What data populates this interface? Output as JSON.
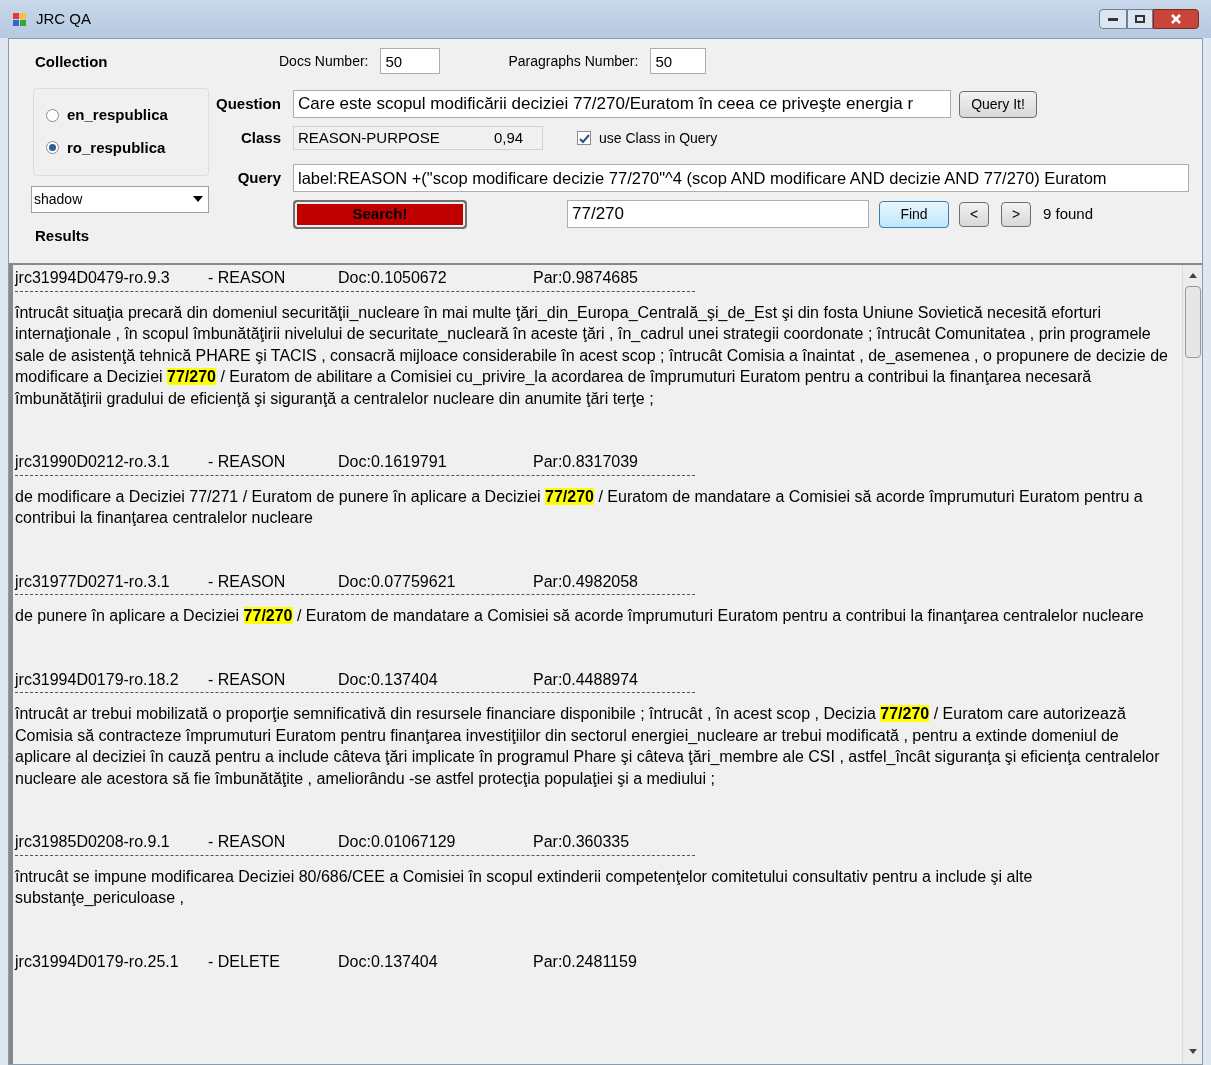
{
  "window": {
    "title": "JRC QA"
  },
  "collection": {
    "label": "Collection",
    "options": [
      {
        "label": "en_respublica",
        "selected": false
      },
      {
        "label": "ro_respublica",
        "selected": true
      }
    ]
  },
  "docs_number": {
    "label": "Docs Number:",
    "value": "50"
  },
  "paragraphs_number": {
    "label": "Paragraphs Number:",
    "value": "50"
  },
  "index_dropdown": {
    "value": "shadow"
  },
  "results_label": "Results",
  "question": {
    "label": "Question",
    "value": "Care este scopul modificării deciziei 77/270/Euratom în ceea ce priveşte energia r"
  },
  "query_button": "Query It!",
  "class": {
    "label": "Class",
    "value": "REASON-PURPOSE",
    "score": "0,94"
  },
  "use_class": {
    "label": "use Class in Query",
    "checked": true
  },
  "query": {
    "label": "Query",
    "value": "label:REASON +(\"scop modificare decizie 77/270\"^4 (scop AND modificare AND decizie AND 77/270) Euratom"
  },
  "search_button": "Search!",
  "find": {
    "value": "77/270",
    "button": "Find",
    "prev": "<",
    "next": ">",
    "count": "9 found"
  },
  "results": [
    {
      "id": "jrc31994D0479-ro.9.3",
      "label": "- REASON",
      "doc": "Doc:0.1050672",
      "par": "Par:0.9874685",
      "text": "întrucât situaţia precară din domeniul securităţii_nucleare în mai multe ţări_din_Europa_Centrală_şi_de_Est şi din fosta Uniune Sovietică necesită eforturi internaţionale , în scopul îmbunătăţirii nivelului de securitate_nucleară în aceste ţări , în_cadrul unei strategii coordonate ; întrucât Comunitatea , prin programele sale de asistenţă tehnică PHARE şi TACIS , consacră mijloace considerabile în acest scop ; întrucât Comisia a înaintat , de_asemenea , o propunere de decizie de modificare a Deciziei **77/270** / Euratom de abilitare a Comisiei cu_privire_la acordarea de împrumuturi Euratom pentru a contribui la finanţarea necesară îmbunătăţirii gradului de eficienţă şi siguranţă a centralelor nucleare din anumite ţări terţe ;"
    },
    {
      "id": "jrc31990D0212-ro.3.1",
      "label": "- REASON",
      "doc": "Doc:0.1619791",
      "par": "Par:0.8317039",
      "text": "de modificare a Deciziei 77/271 / Euratom de punere în aplicare a Deciziei **77/270** / Euratom de mandatare a Comisiei să acorde împrumuturi Euratom pentru a contribui la finanţarea centralelor nucleare"
    },
    {
      "id": "jrc31977D0271-ro.3.1",
      "label": "- REASON",
      "doc": "Doc:0.07759621",
      "par": "Par:0.4982058",
      "text": "de punere în aplicare a Deciziei **77/270** / Euratom de mandatare a Comisiei să acorde împrumuturi Euratom pentru a contribui la finanţarea centralelor nucleare"
    },
    {
      "id": "jrc31994D0179-ro.18.2",
      "label": "- REASON",
      "doc": "Doc:0.137404",
      "par": "Par:0.4488974",
      "text": "întrucât ar trebui mobilizată o proporţie semnificativă din resursele financiare disponibile ; întrucât , în acest scop , Decizia **77/270** / Euratom care autorizează Comisia să contracteze împrumuturi Euratom pentru finanţarea investiţiilor din sectorul energiei_nucleare ar trebui modificată , pentru a extinde domeniul de aplicare al deciziei în cauză pentru a include câteva ţări implicate în programul Phare şi câteva ţări_membre ale CSI , astfel_încât siguranţa şi eficienţa centralelor nucleare ale acestora să fie îmbunătăţite , ameliorându -se astfel protecţia populaţiei şi a mediului ;"
    },
    {
      "id": "jrc31985D0208-ro.9.1",
      "label": "- REASON",
      "doc": "Doc:0.01067129",
      "par": "Par:0.360335",
      "text": "întrucât se impune modificarea Deciziei 80/686/CEE a Comisiei în scopul extinderii competenţelor comitetului consultativ pentru a include şi alte substanţe_periculoase ,"
    },
    {
      "id": "jrc31994D0179-ro.25.1",
      "label": "- DELETE",
      "doc": "Doc:0.137404",
      "par": "Par:0.2481159"
    }
  ]
}
